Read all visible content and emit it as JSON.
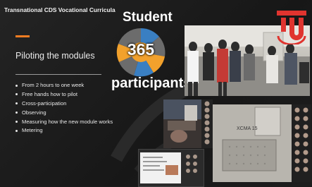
{
  "slide": {
    "title": "Transnational CDS Vocational Curricula",
    "heading": "Piloting the modules",
    "bullets": [
      "From 2 hours to one week",
      "Free hands how to pilot",
      "Cross-participation",
      "Observing",
      "Measuring how the new module works",
      "Metering"
    ]
  },
  "stat": {
    "top_label": "Student",
    "number": "365",
    "bottom_label": "participants",
    "wheel_colors": [
      "#f2a12c",
      "#3a7fc2",
      "#6c6c6c"
    ]
  },
  "photos": {
    "machine_label": "XCMA 15"
  },
  "colors": {
    "accent": "#f07c22",
    "logo_red": "#e0342f"
  },
  "icons": {
    "logo": "tu-logo-icon"
  }
}
